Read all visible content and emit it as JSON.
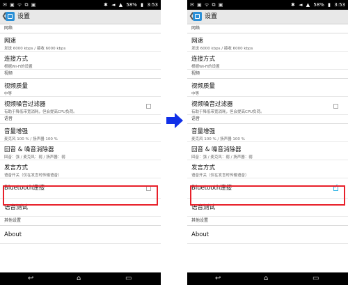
{
  "arrow_color": "#1030e8",
  "highlight_color": "#e8202a",
  "checkbox_accent": "#33b5e5",
  "status": {
    "time": "3:53",
    "battery": "58%",
    "left_icons": "✉ ▣ ᯤ ⧉ ▣",
    "bt_icon": "✱",
    "nfc_icon": "◄",
    "signal_icon": "▲",
    "battery_icon": "▮"
  },
  "nav": {
    "back_icon": "↩",
    "home_icon": "⌂",
    "recent_icon": "▭"
  },
  "screens": [
    {
      "title": "设置",
      "back_icon": "❮",
      "sections": [
        {
          "header": "网络",
          "items": [
            {
              "title": "网速",
              "subtitle": "发送 6000 kbps / 接收 6000 kbps"
            },
            {
              "title": "连接方式",
              "subtitle": "根据Wi-Fi的设置"
            }
          ]
        },
        {
          "header": "视频",
          "items": [
            {
              "title": "视频质量",
              "subtitle": "中等"
            },
            {
              "title": "视频噪音过滤器",
              "subtitle": "有助于降低带宽消耗，但会提高CPU负荷。"
            }
          ]
        },
        {
          "header": "语音",
          "items": [
            {
              "title": "音量增强",
              "subtitle": "麦克风 100 % / 扬声器 100 %"
            },
            {
              "title": "回音 & 噪音消除器",
              "subtitle": "回音：强 / 麦克风：弱 / 扬声器：弱"
            },
            {
              "title": "发言方式",
              "subtitle": "语音开关（仅在发言时传输语音）"
            },
            {
              "title": "Bluetooth连接",
              "subtitle": "",
              "checked": false
            },
            {
              "title": "语音测试",
              "subtitle": ""
            }
          ]
        },
        {
          "header": "其他设置",
          "items": [
            {
              "title": "About",
              "subtitle": ""
            }
          ]
        }
      ]
    },
    {
      "title": "设置",
      "back_icon": "❮",
      "sections": [
        {
          "header": "网络",
          "items": [
            {
              "title": "网速",
              "subtitle": "发送 6000 kbps / 接收 6000 kbps"
            },
            {
              "title": "连接方式",
              "subtitle": "根据Wi-Fi的设置"
            }
          ]
        },
        {
          "header": "视频",
          "items": [
            {
              "title": "视频质量",
              "subtitle": "中等"
            },
            {
              "title": "视频噪音过滤器",
              "subtitle": "有助于降低带宽消耗，但会提高CPU负荷。"
            }
          ]
        },
        {
          "header": "语音",
          "items": [
            {
              "title": "音量增强",
              "subtitle": "麦克风 100 % / 扬声器 100 %"
            },
            {
              "title": "回音 & 噪音消除器",
              "subtitle": "回音：强 / 麦克风：弱 / 扬声器：弱"
            },
            {
              "title": "发言方式",
              "subtitle": "语音开关（仅在发言时传输语音）"
            },
            {
              "title": "Bluetooth连接",
              "subtitle": "",
              "checked": true
            },
            {
              "title": "语音测试",
              "subtitle": ""
            }
          ]
        },
        {
          "header": "其他设置",
          "items": [
            {
              "title": "About",
              "subtitle": ""
            }
          ]
        }
      ]
    }
  ]
}
